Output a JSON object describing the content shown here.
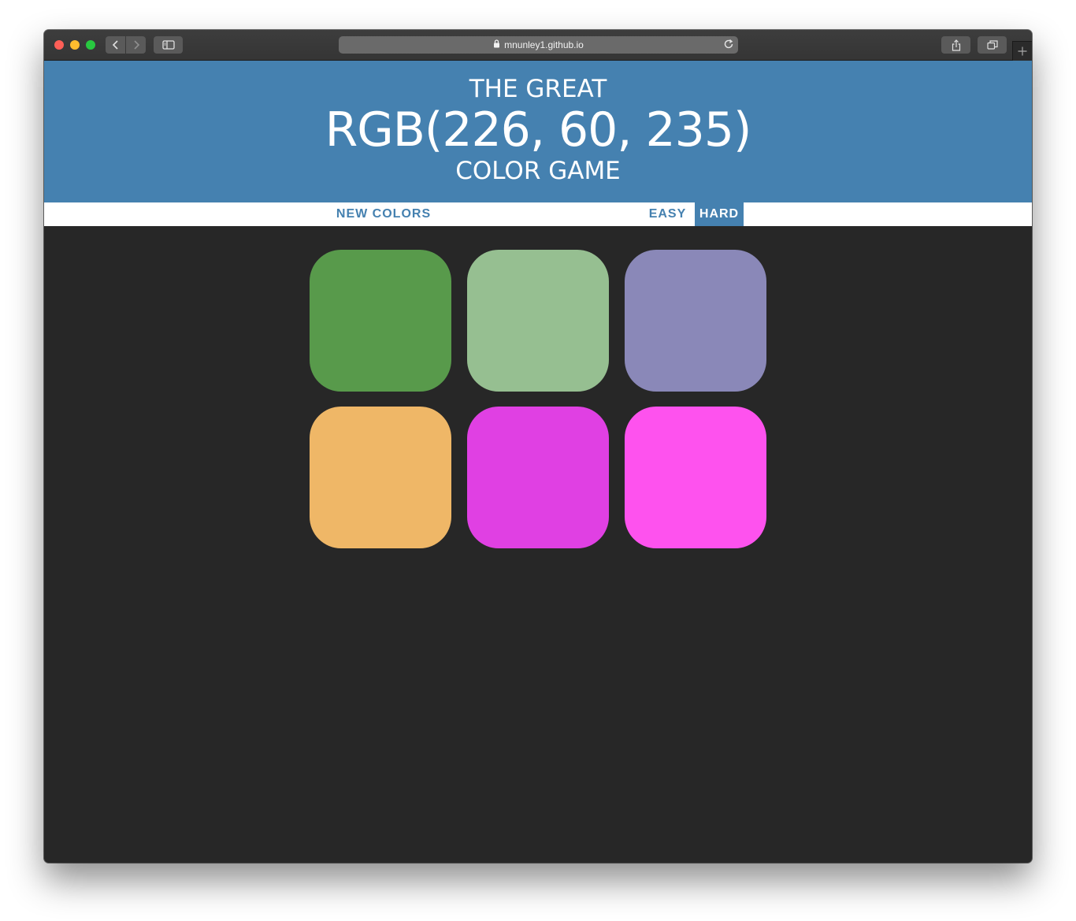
{
  "browser": {
    "url": "mnunley1.github.io"
  },
  "header": {
    "line1": "THE GREAT",
    "color_display": "RGB(226, 60, 235)",
    "line3": "COLOR GAME"
  },
  "controls": {
    "new_colors": "NEW COLORS",
    "easy": "EASY",
    "hard": "HARD",
    "selected_mode": "hard"
  },
  "squares": [
    "#589a4b",
    "#96bf91",
    "#8a88b8",
    "#efb767",
    "#e040e3",
    "#fe52ee"
  ],
  "colors": {
    "header_bg": "#4581b0",
    "page_bg": "#272727",
    "accent": "#4581b0"
  }
}
